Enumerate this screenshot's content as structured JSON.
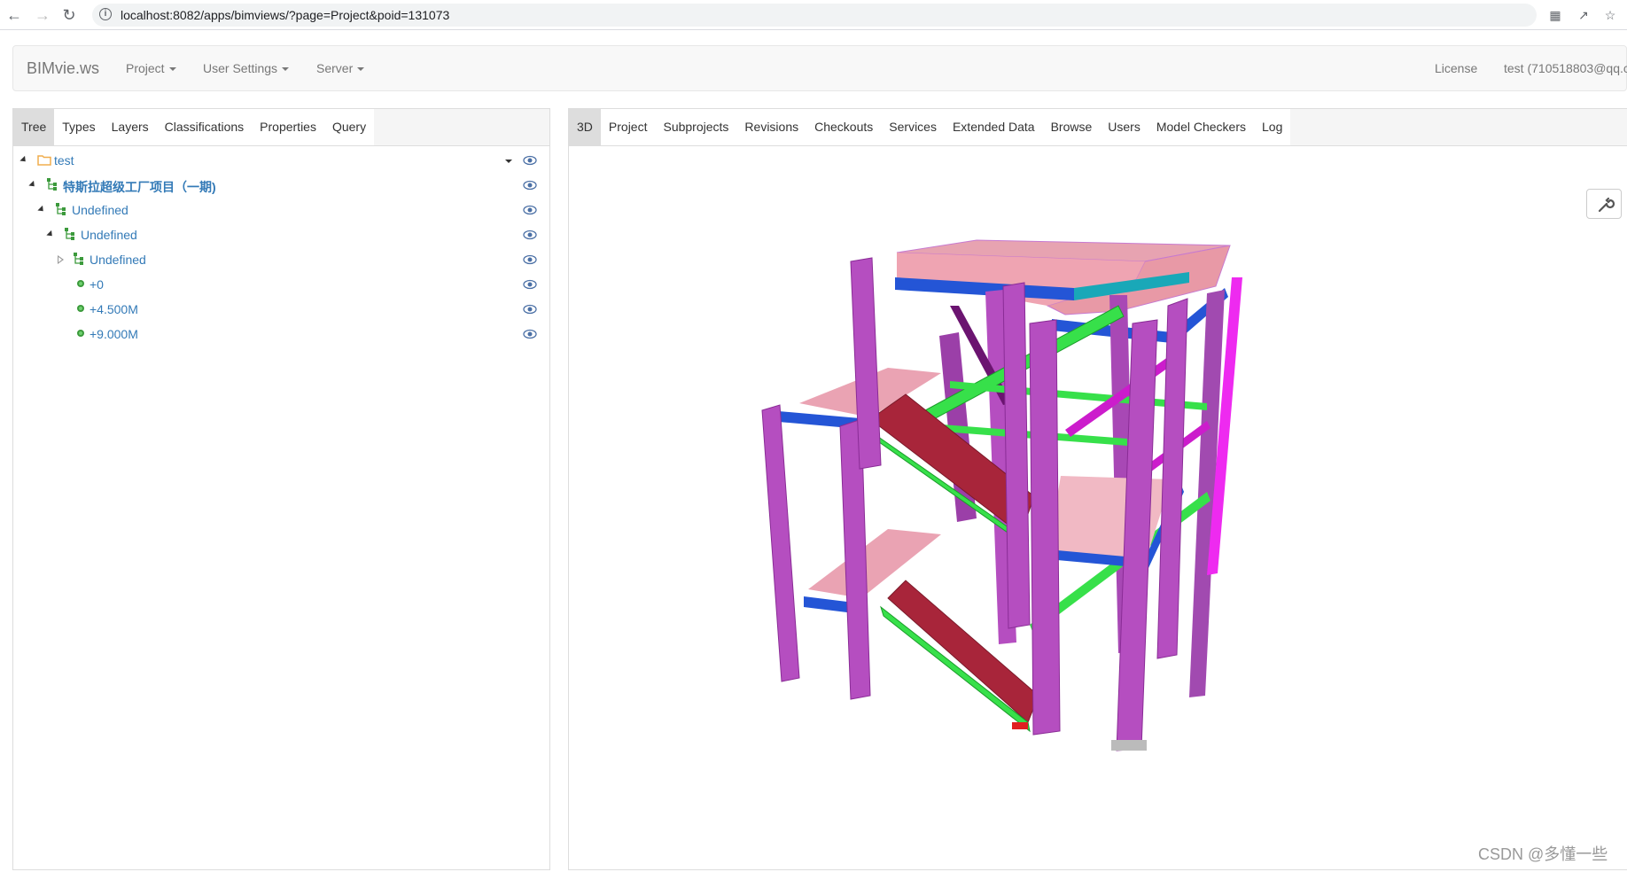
{
  "browser": {
    "url": "localhost:8082/apps/bimviews/?page=Project&poid=131073"
  },
  "navbar": {
    "brand": "BIMvie.ws",
    "menus": [
      "Project",
      "User Settings",
      "Server"
    ],
    "license": "License",
    "user": "test (710518803@qq.c"
  },
  "left_tabs": [
    "Tree",
    "Types",
    "Layers",
    "Classifications",
    "Properties",
    "Query"
  ],
  "right_tabs": [
    "3D",
    "Project",
    "Subprojects",
    "Revisions",
    "Checkouts",
    "Services",
    "Extended Data",
    "Browse",
    "Users",
    "Model Checkers",
    "Log"
  ],
  "tree": [
    {
      "label": "test",
      "level": 0,
      "icon": "folder-icon",
      "expanded": true
    },
    {
      "label": "特斯拉超级工厂项目（一期)",
      "level": 1,
      "icon": "hierarchy-icon",
      "expanded": true
    },
    {
      "label": "Undefined",
      "level": 2,
      "icon": "hierarchy-icon",
      "expanded": true
    },
    {
      "label": "Undefined",
      "level": 3,
      "icon": "hierarchy-icon",
      "expanded": true
    },
    {
      "label": "Undefined",
      "level": 4,
      "icon": "hierarchy-icon",
      "expanded": false
    },
    {
      "label": "+0",
      "level": 5,
      "icon": "storey-dot-icon"
    },
    {
      "label": "+4.500M",
      "level": 5,
      "icon": "storey-dot-icon"
    },
    {
      "label": "+9.000M",
      "level": 5,
      "icon": "storey-dot-icon"
    }
  ],
  "watermark": "CSDN @多懂一些",
  "colors": {
    "column": "#b54ec0",
    "beam_blue": "#2455d6",
    "brace_green": "#37e04a",
    "stair_red": "#a8253a",
    "slab_pink": "#e69aa8",
    "link": "#337ab7"
  }
}
